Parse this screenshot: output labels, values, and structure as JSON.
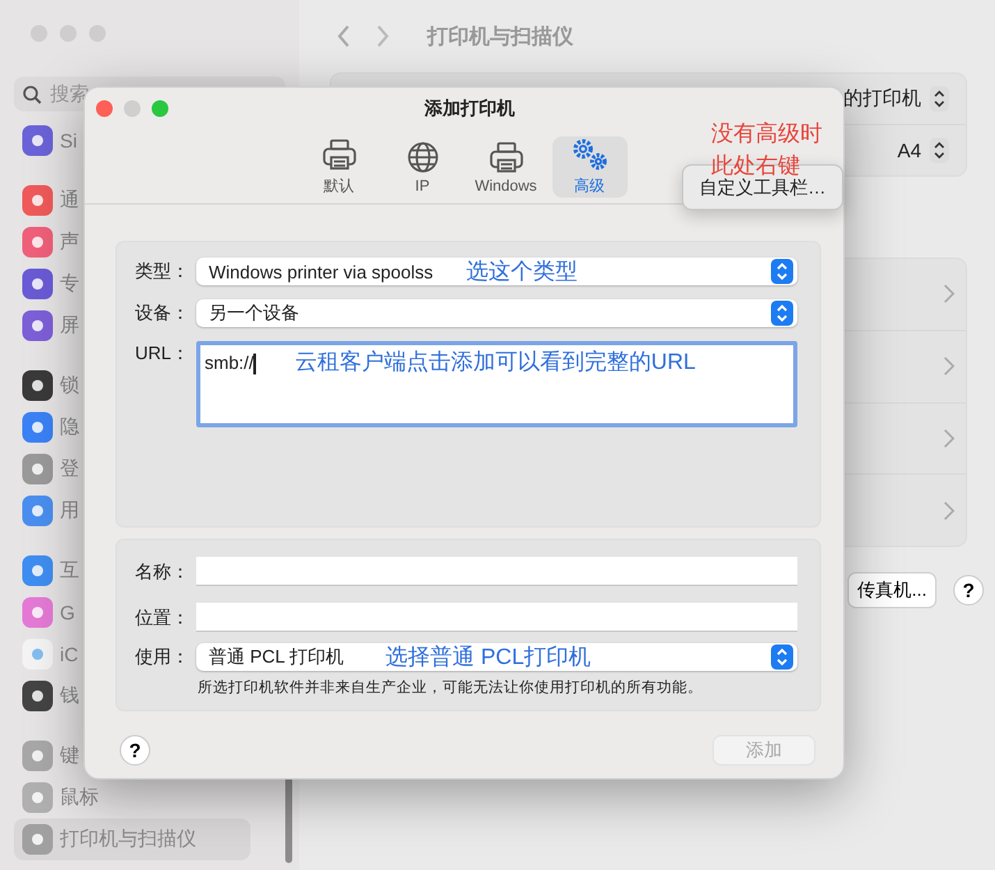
{
  "settings_window": {
    "title": "打印机与扫描仪",
    "search": {
      "placeholder": "搜索"
    },
    "sidebar": {
      "groups": [
        [
          {
            "label": "Si",
            "color": "#6b63d8",
            "selected": false
          }
        ],
        [
          {
            "label": "通",
            "color": "#f05a5a",
            "selected": false
          },
          {
            "label": "声",
            "color": "#f0607a",
            "selected": false
          },
          {
            "label": "专",
            "color": "#6a5bd6",
            "selected": false
          },
          {
            "label": "屏",
            "color": "#7d5fd8",
            "selected": false
          }
        ],
        [
          {
            "label": "锁",
            "color": "#3a3a3a",
            "selected": false
          },
          {
            "label": "隐",
            "color": "#3b82f6",
            "selected": false
          },
          {
            "label": "登",
            "color": "#9a9a9a",
            "selected": false
          },
          {
            "label": "用",
            "color": "#4a8ff0",
            "selected": false
          }
        ],
        [
          {
            "label": "互",
            "color": "#3f8ef2",
            "selected": false
          },
          {
            "label": "G",
            "color": "#e57ad6",
            "selected": false
          },
          {
            "label": "iC",
            "color": "#f4f4f4",
            "selected": false
          },
          {
            "label": "钱",
            "color": "#444444",
            "selected": false
          }
        ],
        [
          {
            "label": "键",
            "color": "#a8a8a8",
            "selected": false
          },
          {
            "label": "鼠标",
            "color": "#b0b0b0",
            "selected": false
          },
          {
            "label": "打印机与扫描仪",
            "color": "#a0a0a0",
            "selected": true
          }
        ]
      ]
    },
    "top_panel": [
      {
        "value": "的打印机"
      },
      {
        "value": "A4"
      }
    ],
    "fax_button": "传真机...",
    "help_button": "?"
  },
  "dialog": {
    "title": "添加打印机",
    "toolbar": [
      {
        "label": "默认",
        "kind": "printer",
        "selected": false
      },
      {
        "label": "IP",
        "kind": "globe",
        "selected": false
      },
      {
        "label": "Windows",
        "kind": "printer",
        "selected": false
      },
      {
        "label": "高级",
        "kind": "gears",
        "selected": true
      }
    ],
    "toolbar_annotation": {
      "lines": [
        "没有高级时",
        "此处右键"
      ],
      "color": "#e8443a"
    },
    "context_menu": {
      "items": [
        "自定义工具栏…"
      ]
    },
    "connection": {
      "type": {
        "label": "类型：",
        "value": "Windows printer via spoolss",
        "annotation": {
          "text": "选这个类型",
          "color": "#2f6fdc"
        }
      },
      "device": {
        "label": "设备：",
        "value": "另一个设备"
      },
      "url": {
        "label": "URL：",
        "value": "smb://",
        "focused": true,
        "annotation": {
          "text": "云租客户端点击添加可以看到完整的URL",
          "color": "#2f6fdc"
        }
      }
    },
    "details": {
      "name": {
        "label": "名称："
      },
      "location": {
        "label": "位置："
      },
      "use": {
        "label": "使用：",
        "value": "普通 PCL 打印机",
        "annotation": {
          "text": "选择普通 PCL打印机",
          "color": "#2f6fdc"
        }
      },
      "note": "所选打印机软件并非来自生产企业，可能无法让你使用打印机的所有功能。"
    },
    "help_button": "?",
    "add_button": {
      "label": "添加",
      "disabled": true
    }
  }
}
